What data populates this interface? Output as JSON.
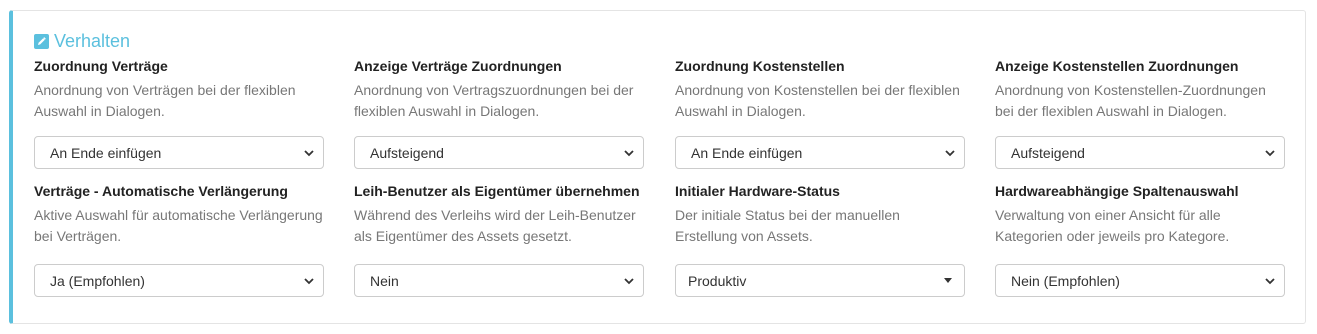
{
  "panel": {
    "title": "Verhalten",
    "accent_color": "#5bc0de",
    "fields": [
      {
        "label": "Zuordnung Verträge",
        "desc": "Anordnung von Verträgen bei der flexiblen Auswahl in Dialogen.",
        "value": "An Ende einfügen",
        "control_icon": "chevron-down-icon"
      },
      {
        "label": "Anzeige Verträge Zuordnungen",
        "desc": "Anordnung von Vertragszuordnungen bei der flexiblen Auswahl in Dialogen.",
        "value": "Aufsteigend",
        "control_icon": "chevron-down-icon"
      },
      {
        "label": "Zuordnung Kostenstellen",
        "desc": "Anordnung von Kostenstellen bei der flexiblen Auswahl in Dialogen.",
        "value": "An Ende einfügen",
        "control_icon": "chevron-down-icon"
      },
      {
        "label": "Anzeige Kostenstellen Zuordnungen",
        "desc": "Anordnung von Kostenstellen-Zuordnungen bei der flexiblen Auswahl in Dialogen.",
        "value": "Aufsteigend",
        "control_icon": "chevron-down-icon"
      },
      {
        "label": "Verträge - Automatische Verlängerung",
        "desc": "Aktive Auswahl für automatische Verlängerung bei Verträgen.",
        "value": "Ja (Empfohlen)",
        "control_icon": "chevron-down-icon"
      },
      {
        "label": "Leih-Benutzer als Eigentümer übernehmen",
        "desc": "Während des Verleihs wird der Leih-Benutzer als Eigentümer des Assets gesetzt.",
        "value": "Nein",
        "control_icon": "chevron-down-icon"
      },
      {
        "label": "Initialer Hardware-Status",
        "desc": "Der initiale Status bei der manuellen Erstellung von Assets.",
        "value": "Produktiv",
        "control_icon": "caret-down-icon"
      },
      {
        "label": "Hardwareabhängige Spaltenauswahl",
        "desc": "Verwaltung von einer Ansicht für alle Kategorien oder jeweils pro Kategore.",
        "value": "Nein (Empfohlen)",
        "control_icon": "chevron-down-icon"
      }
    ]
  }
}
